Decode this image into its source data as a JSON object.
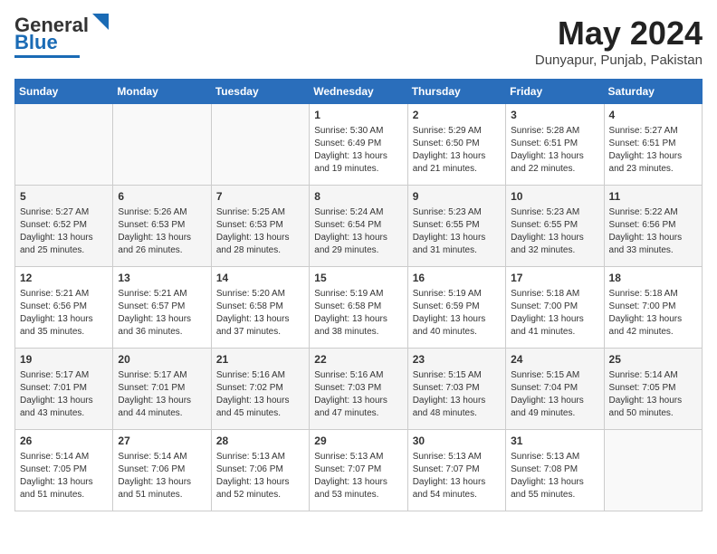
{
  "header": {
    "logo_line1": "General",
    "logo_line2": "Blue",
    "month": "May 2024",
    "location": "Dunyapur, Punjab, Pakistan"
  },
  "weekdays": [
    "Sunday",
    "Monday",
    "Tuesday",
    "Wednesday",
    "Thursday",
    "Friday",
    "Saturday"
  ],
  "weeks": [
    [
      {
        "day": "",
        "info": ""
      },
      {
        "day": "",
        "info": ""
      },
      {
        "day": "",
        "info": ""
      },
      {
        "day": "1",
        "info": "Sunrise: 5:30 AM\nSunset: 6:49 PM\nDaylight: 13 hours and 19 minutes."
      },
      {
        "day": "2",
        "info": "Sunrise: 5:29 AM\nSunset: 6:50 PM\nDaylight: 13 hours and 21 minutes."
      },
      {
        "day": "3",
        "info": "Sunrise: 5:28 AM\nSunset: 6:51 PM\nDaylight: 13 hours and 22 minutes."
      },
      {
        "day": "4",
        "info": "Sunrise: 5:27 AM\nSunset: 6:51 PM\nDaylight: 13 hours and 23 minutes."
      }
    ],
    [
      {
        "day": "5",
        "info": "Sunrise: 5:27 AM\nSunset: 6:52 PM\nDaylight: 13 hours and 25 minutes."
      },
      {
        "day": "6",
        "info": "Sunrise: 5:26 AM\nSunset: 6:53 PM\nDaylight: 13 hours and 26 minutes."
      },
      {
        "day": "7",
        "info": "Sunrise: 5:25 AM\nSunset: 6:53 PM\nDaylight: 13 hours and 28 minutes."
      },
      {
        "day": "8",
        "info": "Sunrise: 5:24 AM\nSunset: 6:54 PM\nDaylight: 13 hours and 29 minutes."
      },
      {
        "day": "9",
        "info": "Sunrise: 5:23 AM\nSunset: 6:55 PM\nDaylight: 13 hours and 31 minutes."
      },
      {
        "day": "10",
        "info": "Sunrise: 5:23 AM\nSunset: 6:55 PM\nDaylight: 13 hours and 32 minutes."
      },
      {
        "day": "11",
        "info": "Sunrise: 5:22 AM\nSunset: 6:56 PM\nDaylight: 13 hours and 33 minutes."
      }
    ],
    [
      {
        "day": "12",
        "info": "Sunrise: 5:21 AM\nSunset: 6:56 PM\nDaylight: 13 hours and 35 minutes."
      },
      {
        "day": "13",
        "info": "Sunrise: 5:21 AM\nSunset: 6:57 PM\nDaylight: 13 hours and 36 minutes."
      },
      {
        "day": "14",
        "info": "Sunrise: 5:20 AM\nSunset: 6:58 PM\nDaylight: 13 hours and 37 minutes."
      },
      {
        "day": "15",
        "info": "Sunrise: 5:19 AM\nSunset: 6:58 PM\nDaylight: 13 hours and 38 minutes."
      },
      {
        "day": "16",
        "info": "Sunrise: 5:19 AM\nSunset: 6:59 PM\nDaylight: 13 hours and 40 minutes."
      },
      {
        "day": "17",
        "info": "Sunrise: 5:18 AM\nSunset: 7:00 PM\nDaylight: 13 hours and 41 minutes."
      },
      {
        "day": "18",
        "info": "Sunrise: 5:18 AM\nSunset: 7:00 PM\nDaylight: 13 hours and 42 minutes."
      }
    ],
    [
      {
        "day": "19",
        "info": "Sunrise: 5:17 AM\nSunset: 7:01 PM\nDaylight: 13 hours and 43 minutes."
      },
      {
        "day": "20",
        "info": "Sunrise: 5:17 AM\nSunset: 7:01 PM\nDaylight: 13 hours and 44 minutes."
      },
      {
        "day": "21",
        "info": "Sunrise: 5:16 AM\nSunset: 7:02 PM\nDaylight: 13 hours and 45 minutes."
      },
      {
        "day": "22",
        "info": "Sunrise: 5:16 AM\nSunset: 7:03 PM\nDaylight: 13 hours and 47 minutes."
      },
      {
        "day": "23",
        "info": "Sunrise: 5:15 AM\nSunset: 7:03 PM\nDaylight: 13 hours and 48 minutes."
      },
      {
        "day": "24",
        "info": "Sunrise: 5:15 AM\nSunset: 7:04 PM\nDaylight: 13 hours and 49 minutes."
      },
      {
        "day": "25",
        "info": "Sunrise: 5:14 AM\nSunset: 7:05 PM\nDaylight: 13 hours and 50 minutes."
      }
    ],
    [
      {
        "day": "26",
        "info": "Sunrise: 5:14 AM\nSunset: 7:05 PM\nDaylight: 13 hours and 51 minutes."
      },
      {
        "day": "27",
        "info": "Sunrise: 5:14 AM\nSunset: 7:06 PM\nDaylight: 13 hours and 51 minutes."
      },
      {
        "day": "28",
        "info": "Sunrise: 5:13 AM\nSunset: 7:06 PM\nDaylight: 13 hours and 52 minutes."
      },
      {
        "day": "29",
        "info": "Sunrise: 5:13 AM\nSunset: 7:07 PM\nDaylight: 13 hours and 53 minutes."
      },
      {
        "day": "30",
        "info": "Sunrise: 5:13 AM\nSunset: 7:07 PM\nDaylight: 13 hours and 54 minutes."
      },
      {
        "day": "31",
        "info": "Sunrise: 5:13 AM\nSunset: 7:08 PM\nDaylight: 13 hours and 55 minutes."
      },
      {
        "day": "",
        "info": ""
      }
    ]
  ]
}
